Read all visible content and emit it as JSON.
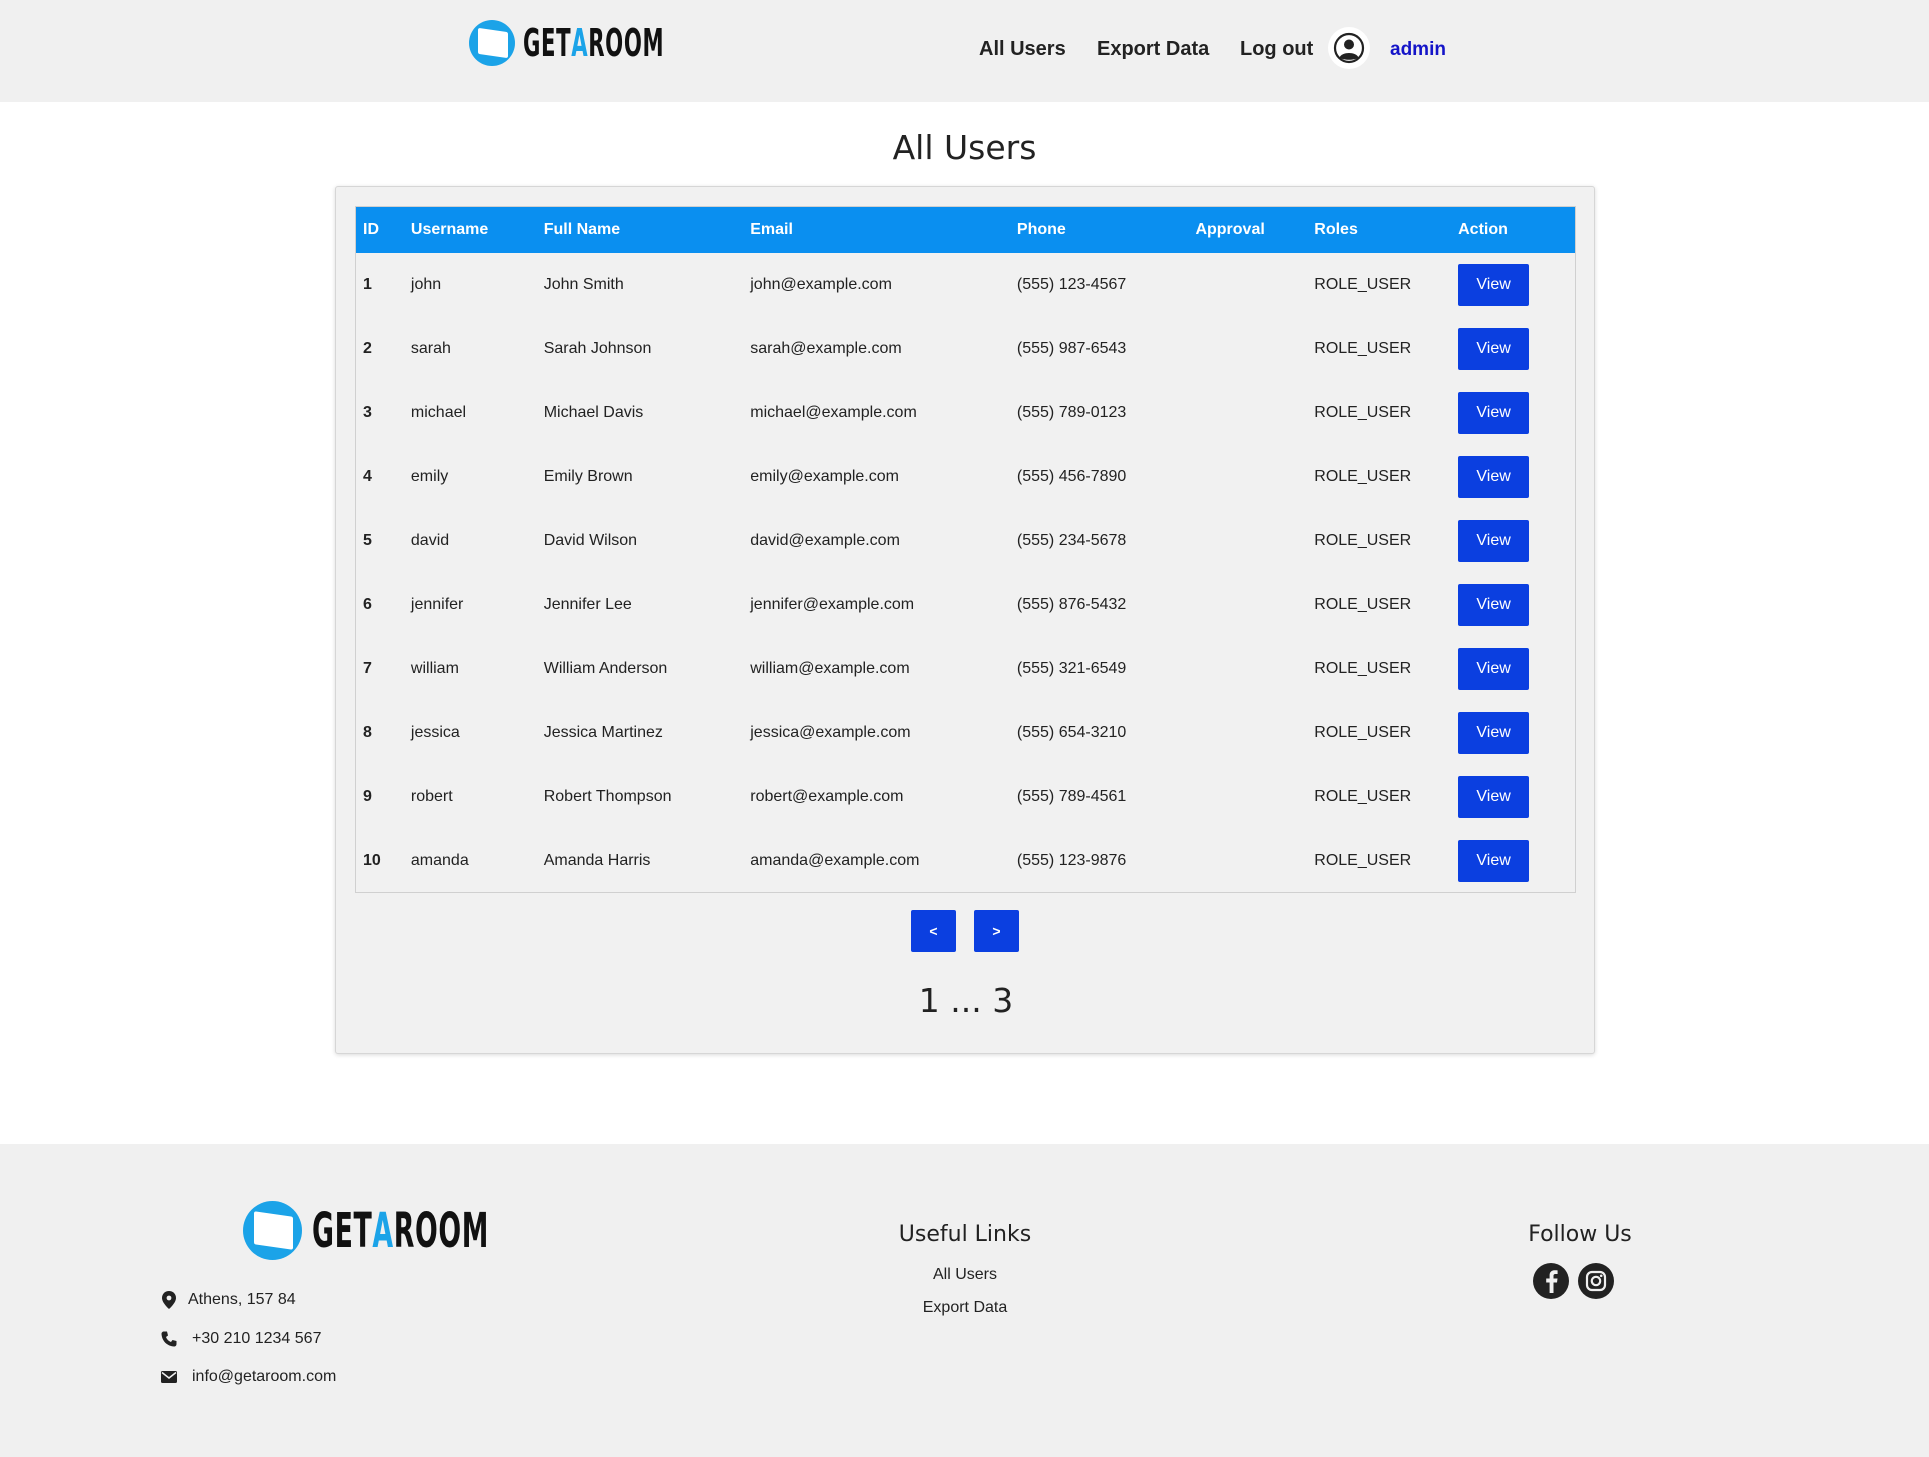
{
  "brand": {
    "logo_get": "GET",
    "logo_a": "A",
    "logo_room": "ROOM",
    "accent_color": "#1ba3e8"
  },
  "nav": {
    "all_users": "All Users",
    "export_data": "Export Data",
    "log_out": "Log out",
    "user_icon": "user-circle-icon",
    "username": "admin"
  },
  "page": {
    "title": "All Users"
  },
  "table": {
    "headers": [
      "ID",
      "Username",
      "Full Name",
      "Email",
      "Phone",
      "Approval",
      "Roles",
      "Action"
    ],
    "header_color": "#0a8ff0",
    "button_color": "#0b3fe0",
    "rows": [
      {
        "id": "1",
        "username": "john",
        "full_name": "John Smith",
        "email": "john@example.com",
        "phone": "(555) 123-4567",
        "approval": "",
        "roles": "ROLE_USER",
        "action": "View"
      },
      {
        "id": "2",
        "username": "sarah",
        "full_name": "Sarah Johnson",
        "email": "sarah@example.com",
        "phone": "(555) 987-6543",
        "approval": "",
        "roles": "ROLE_USER",
        "action": "View"
      },
      {
        "id": "3",
        "username": "michael",
        "full_name": "Michael Davis",
        "email": "michael@example.com",
        "phone": "(555) 789-0123",
        "approval": "",
        "roles": "ROLE_USER",
        "action": "View"
      },
      {
        "id": "4",
        "username": "emily",
        "full_name": "Emily Brown",
        "email": "emily@example.com",
        "phone": "(555) 456-7890",
        "approval": "",
        "roles": "ROLE_USER",
        "action": "View"
      },
      {
        "id": "5",
        "username": "david",
        "full_name": "David Wilson",
        "email": "david@example.com",
        "phone": "(555) 234-5678",
        "approval": "",
        "roles": "ROLE_USER",
        "action": "View"
      },
      {
        "id": "6",
        "username": "jennifer",
        "full_name": "Jennifer Lee",
        "email": "jennifer@example.com",
        "phone": "(555) 876-5432",
        "approval": "",
        "roles": "ROLE_USER",
        "action": "View"
      },
      {
        "id": "7",
        "username": "william",
        "full_name": "William Anderson",
        "email": "william@example.com",
        "phone": "(555) 321-6549",
        "approval": "",
        "roles": "ROLE_USER",
        "action": "View"
      },
      {
        "id": "8",
        "username": "jessica",
        "full_name": "Jessica Martinez",
        "email": "jessica@example.com",
        "phone": "(555) 654-3210",
        "approval": "",
        "roles": "ROLE_USER",
        "action": "View"
      },
      {
        "id": "9",
        "username": "robert",
        "full_name": "Robert Thompson",
        "email": "robert@example.com",
        "phone": "(555) 789-4561",
        "approval": "",
        "roles": "ROLE_USER",
        "action": "View"
      },
      {
        "id": "10",
        "username": "amanda",
        "full_name": "Amanda Harris",
        "email": "amanda@example.com",
        "phone": "(555) 123-9876",
        "approval": "",
        "roles": "ROLE_USER",
        "action": "View"
      }
    ]
  },
  "pagination": {
    "prev_label": "<",
    "next_label": ">",
    "indicator": "1 ... 3"
  },
  "footer": {
    "address": "Athens, 157 84",
    "phone": "+30 210 1234 567",
    "email": "info@getaroom.com",
    "address_icon": "map-pin-icon",
    "phone_icon": "phone-icon",
    "email_icon": "envelope-icon",
    "useful_links_title": "Useful Links",
    "useful_links": [
      "All Users",
      "Export Data"
    ],
    "follow_title": "Follow Us",
    "social_icons": [
      "facebook-icon",
      "instagram-icon"
    ]
  }
}
